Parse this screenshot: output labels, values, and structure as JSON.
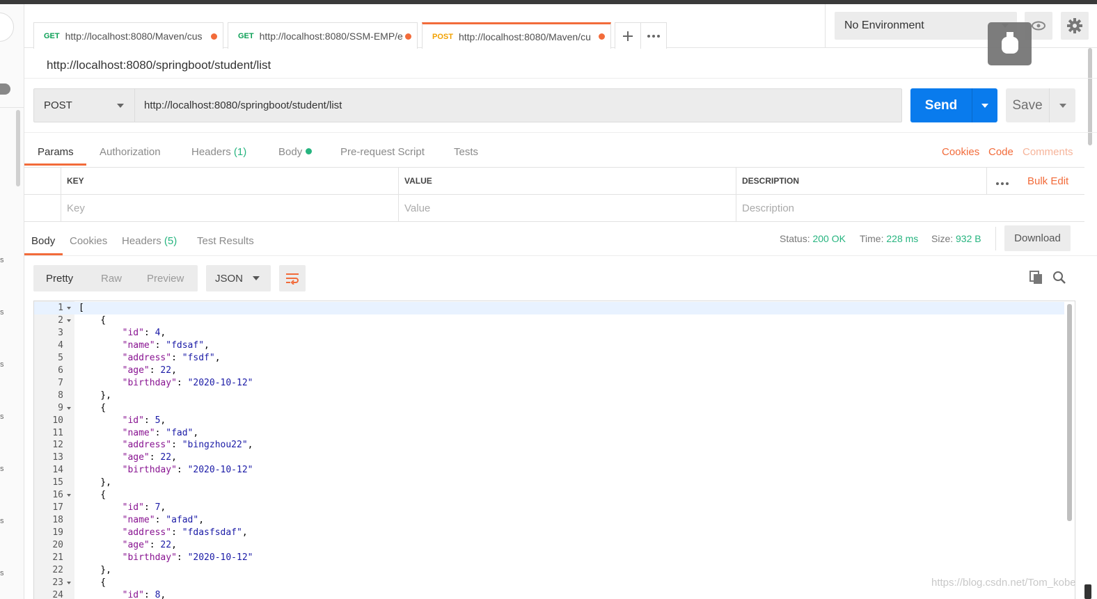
{
  "tabs": [
    {
      "method": "GET",
      "url": "http://localhost:8080/Maven/cus"
    },
    {
      "method": "GET",
      "url": "http://localhost:8080/SSM-EMP/e"
    },
    {
      "method": "POST",
      "url": "http://localhost:8080/Maven/cu"
    }
  ],
  "environment": {
    "selected": "No Environment"
  },
  "request": {
    "title": "http://localhost:8080/springboot/student/list",
    "method": "POST",
    "url": "http://localhost:8080/springboot/student/list",
    "send_label": "Send",
    "save_label": "Save"
  },
  "request_tabs": {
    "params": "Params",
    "authorization": "Authorization",
    "headers": "Headers",
    "headers_count": "(1)",
    "body": "Body",
    "prerequest": "Pre-request Script",
    "tests": "Tests",
    "cookies": "Cookies",
    "code": "Code",
    "comments": "Comments"
  },
  "params_table": {
    "headers": {
      "key": "KEY",
      "value": "VALUE",
      "description": "DESCRIPTION",
      "bulk_edit": "Bulk Edit"
    },
    "placeholders": {
      "key": "Key",
      "value": "Value",
      "description": "Description"
    }
  },
  "response_tabs": {
    "body": "Body",
    "cookies": "Cookies",
    "headers": "Headers",
    "headers_count": "(5)",
    "test_results": "Test Results"
  },
  "response_meta": {
    "status_label": "Status:",
    "status": "200 OK",
    "time_label": "Time:",
    "time": "228 ms",
    "size_label": "Size:",
    "size": "932 B",
    "download": "Download"
  },
  "view": {
    "pretty": "Pretty",
    "raw": "Raw",
    "preview": "Preview",
    "format": "JSON"
  },
  "code_lines": [
    "[",
    "    {",
    "        \"id\": 4,",
    "        \"name\": \"fdsaf\",",
    "        \"address\": \"fsdf\",",
    "        \"age\": 22,",
    "        \"birthday\": \"2020-10-12\"",
    "    },",
    "    {",
    "        \"id\": 5,",
    "        \"name\": \"fad\",",
    "        \"address\": \"bingzhou22\",",
    "        \"age\": 22,",
    "        \"birthday\": \"2020-10-12\"",
    "    },",
    "    {",
    "        \"id\": 7,",
    "        \"name\": \"afad\",",
    "        \"address\": \"fdasfsdaf\",",
    "        \"age\": 22,",
    "        \"birthday\": \"2020-10-12\"",
    "    },",
    "    {",
    "        \"id\": 8,"
  ],
  "fold_lines": [
    1,
    2,
    9,
    16,
    23
  ],
  "watermark": "https://blog.csdn.net/Tom_kobe",
  "colors": {
    "accent": "#f26b3a",
    "send": "#097bed",
    "success": "#26b47f",
    "get": "#0b9f55",
    "post": "#f2a100"
  }
}
